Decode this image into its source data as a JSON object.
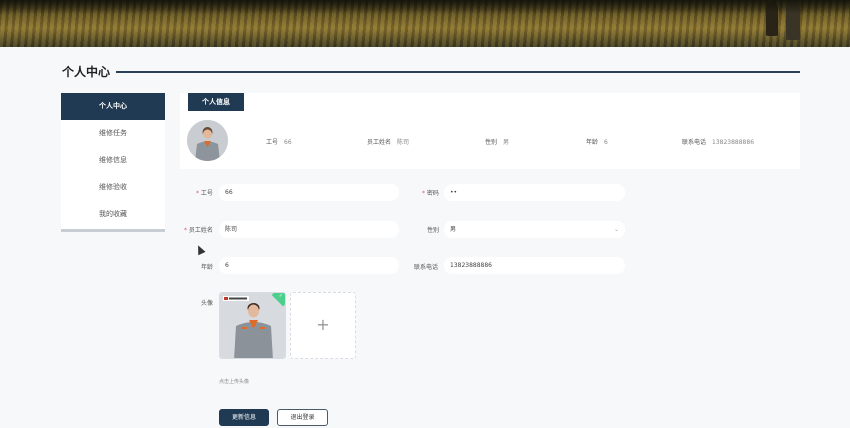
{
  "page_title": "个人中心",
  "sidebar": {
    "items": [
      {
        "label": "个人中心"
      },
      {
        "label": "维修任务"
      },
      {
        "label": "维修信息"
      },
      {
        "label": "维修验收"
      },
      {
        "label": "我的收藏"
      }
    ]
  },
  "info_card": {
    "tab_label": "个人信息",
    "fields": [
      {
        "label": "工号",
        "value": "66"
      },
      {
        "label": "员工姓名",
        "value": "陈司"
      },
      {
        "label": "性别",
        "value": "男"
      },
      {
        "label": "年龄",
        "value": "6"
      },
      {
        "label": "联系电话",
        "value": "13823888886"
      }
    ]
  },
  "form": {
    "employee_id": {
      "label": "工号",
      "value": "66"
    },
    "password": {
      "label": "密码",
      "value": "••"
    },
    "name": {
      "label": "员工姓名",
      "value": "陈司"
    },
    "gender": {
      "label": "性别",
      "value": "男"
    },
    "age": {
      "label": "年龄",
      "value": "6"
    },
    "phone": {
      "label": "联系电话",
      "value": "13823888886"
    },
    "avatar": {
      "label": "头像",
      "tip": "点击上传头像",
      "add_symbol": "+",
      "check_symbol": "✓"
    }
  },
  "buttons": {
    "update": "更新信息",
    "logout": "退出登录"
  },
  "icons": {
    "select_arrow": "chevron-down-icon",
    "upload": "plus-icon",
    "success": "check-icon"
  },
  "colors": {
    "primary": "#1f3a52",
    "success": "#4ccf8c",
    "required": "#e05a5a"
  }
}
